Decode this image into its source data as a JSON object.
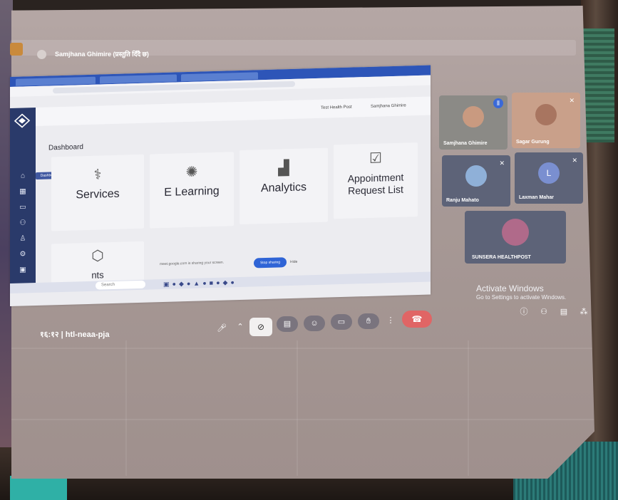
{
  "meeting": {
    "presenter_label": "Samjhana Ghimire (प्रस्तुति दिँदै छ)",
    "room_code": "१६:१२ | htl-neaa-pja",
    "activate_windows_title": "Activate Windows",
    "activate_windows_sub": "Go to Settings to activate Windows."
  },
  "shared_app": {
    "top_facility": "Test Health Post",
    "top_user": "Samjhana Ghimire",
    "sidebar_active": "Dashboard",
    "page_title": "Dashboard",
    "cards": [
      {
        "label": "Services",
        "icon": "stethoscope-icon"
      },
      {
        "label": "E Learning",
        "icon": "lightbulb-icon"
      },
      {
        "label": "Analytics",
        "icon": "bar-chart-icon"
      },
      {
        "label": "Appointment Request List",
        "icon": "calendar-check-icon"
      },
      {
        "label": "nts",
        "icon": "user-hexagon-icon"
      }
    ],
    "share_notice": "meet.google.com is sharing your screen.",
    "stop_sharing": "Stop sharing",
    "hide": "Hide",
    "taskbar_search": "Search"
  },
  "participants": [
    {
      "name": "Samjhana Ghimire",
      "initial": ""
    },
    {
      "name": "Sagar Gurung",
      "initial": ""
    },
    {
      "name": "Ranju Mahato",
      "initial": ""
    },
    {
      "name": "Laxman Mahar",
      "initial": "L"
    },
    {
      "name": "SUNSERA HEALTHPOST",
      "initial": ""
    }
  ],
  "colors": {
    "end_call": "#e06565",
    "sidebar": "#2a3a6a",
    "stop_sharing": "#2f64d6"
  }
}
